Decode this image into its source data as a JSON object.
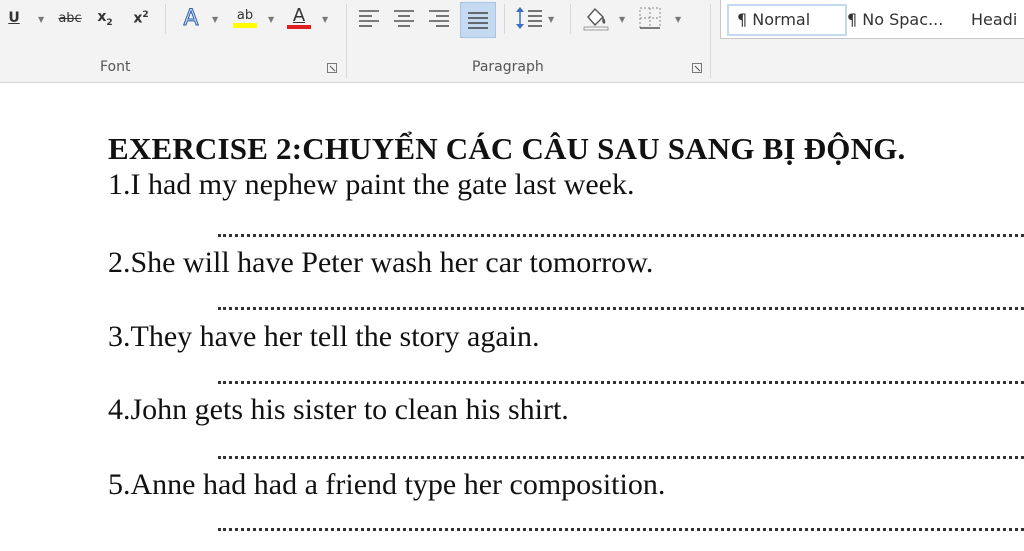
{
  "ribbon": {
    "font_group_label": "Font",
    "paragraph_group_label": "Paragraph",
    "styles": [
      {
        "label": "¶ Normal",
        "selected": true
      },
      {
        "label": "¶ No Spac...",
        "selected": false
      },
      {
        "label": "Headi",
        "selected": false
      }
    ],
    "icons": {
      "underline": "U",
      "strikethrough": "abc",
      "subscript_base": "x",
      "subscript_mark": "2",
      "superscript_base": "x",
      "superscript_mark": "2",
      "text_effects": "A",
      "highlight": "ab",
      "font_color": "A"
    },
    "colors": {
      "highlight": "#ffff00",
      "font_color": "#e02020",
      "justify_active": "#c5d9f1"
    }
  },
  "document": {
    "title": "EXERCISE 2:CHUYỂN CÁC CÂU SAU SANG BỊ ĐỘNG.",
    "sentences": [
      "1.I had my nephew paint the gate last week.",
      "2.She will have Peter wash her car tomorrow.",
      "3.They have her tell the story again.",
      "4.John gets his sister to clean his shirt.",
      "5.Anne had had a friend type her composition."
    ]
  }
}
